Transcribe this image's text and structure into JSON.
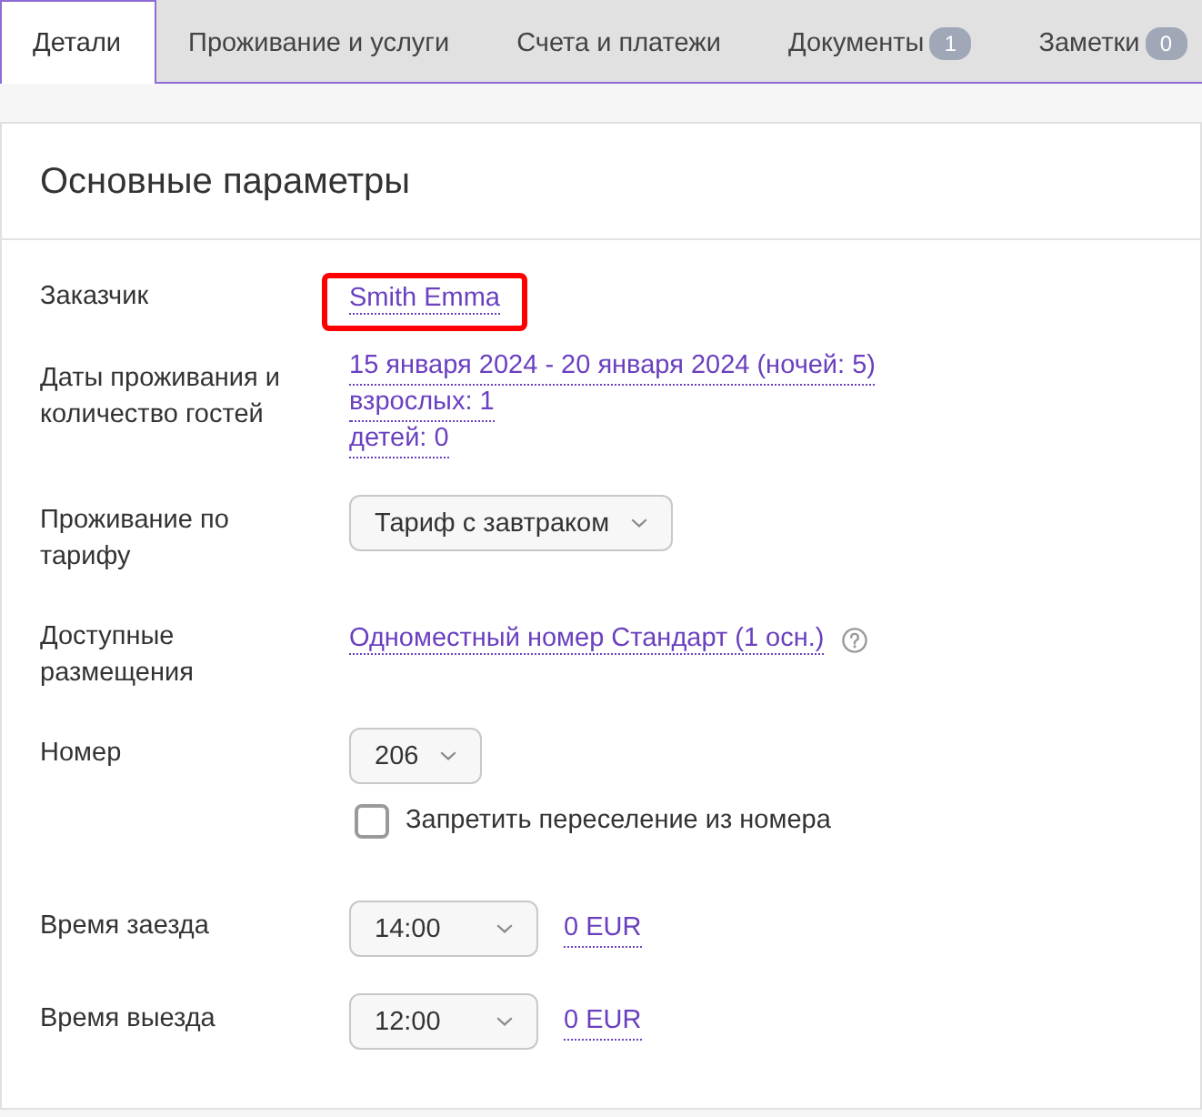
{
  "tabs": [
    {
      "label": "Детали",
      "selected": true
    },
    {
      "label": "Проживание и услуги",
      "selected": false
    },
    {
      "label": "Счета и платежи",
      "selected": false
    },
    {
      "label": "Документы",
      "badge": "1",
      "selected": false
    },
    {
      "label": "Заметки",
      "badge": "0",
      "selected": false
    }
  ],
  "section": {
    "title": "Основные параметры"
  },
  "fields": [
    {
      "kind": "link",
      "label": "Заказчик",
      "value": "Smith Emma",
      "highlighted": true
    },
    {
      "kind": "lines",
      "label": "Даты проживания и количество гостей",
      "values": [
        "15 января 2024 - 20 января 2024 (ночей: 5)",
        "взрослых: 1",
        "детей: 0"
      ]
    },
    {
      "kind": "select",
      "label": "Проживание по тарифу",
      "value": "Тариф с завтраком"
    },
    {
      "kind": "link",
      "label": "Доступные размещения",
      "value": "Одноместный номер Стандарт (1 осн.)",
      "help": true
    },
    {
      "kind": "select",
      "label": "Номер",
      "value": "206",
      "checkbox": {
        "label": "Запретить переселение из номера",
        "checked": false
      }
    },
    {
      "kind": "time",
      "label": "Время заезда",
      "value": "14:00",
      "price": "0 EUR"
    },
    {
      "kind": "time",
      "label": "Время выезда",
      "value": "12:00",
      "price": "0 EUR"
    }
  ]
}
